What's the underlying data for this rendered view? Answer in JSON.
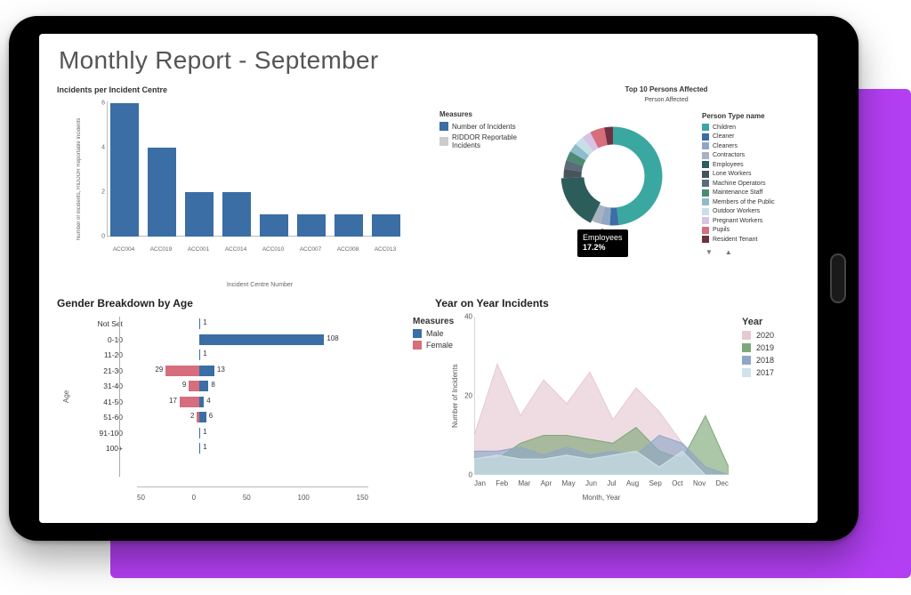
{
  "page_title": "Monthly Report - September",
  "chart_data": [
    {
      "id": "incidents_per_centre",
      "type": "bar",
      "title": "Incidents per Incident Centre",
      "xlabel": "Incident Centre Number",
      "ylabel": "Number of Incidents, RIDDOR Reportable Incidents",
      "ylim": [
        0,
        6
      ],
      "yticks": [
        0,
        2,
        4,
        6
      ],
      "categories": [
        "ACC004",
        "ACC019",
        "ACC001",
        "ACC014",
        "ACC010",
        "ACC007",
        "ACC008",
        "ACC013"
      ],
      "series": [
        {
          "name": "Number of Incidents",
          "values": [
            6,
            4,
            2,
            2,
            1,
            1,
            1,
            1
          ],
          "color": "#3a6ea5"
        }
      ],
      "legend_title": "Measures",
      "legend_items": [
        {
          "label": "Number of Incidents",
          "color": "#3a6ea5"
        },
        {
          "label": "RIDDOR Reportable Incidents",
          "color": "#cccccc"
        }
      ]
    },
    {
      "id": "persons_affected",
      "type": "pie",
      "title": "Top 10 Persons Affected",
      "subtitle": "Person Affected",
      "legend_title": "Person Type name",
      "slices": [
        {
          "label": "Children",
          "value": 48.0,
          "color": "#3aa7a0"
        },
        {
          "label": "Cleaner",
          "value": 3.0,
          "color": "#3a6ea5"
        },
        {
          "label": "Cleaners",
          "value": 3.0,
          "color": "#8fa7c6"
        },
        {
          "label": "Contractors",
          "value": 3.0,
          "color": "#a7b3c0"
        },
        {
          "label": "Employees",
          "value": 17.2,
          "color": "#2c5d5a"
        },
        {
          "label": "Lone Workers",
          "value": 3.0,
          "color": "#46555c"
        },
        {
          "label": "Machine Operators",
          "value": 3.0,
          "color": "#5b6c78"
        },
        {
          "label": "Maintenance Staff",
          "value": 3.0,
          "color": "#4c8a73"
        },
        {
          "label": "Members of the Public",
          "value": 3.0,
          "color": "#8fbccc"
        },
        {
          "label": "Outdoor Workers",
          "value": 3.0,
          "color": "#c7e0e7"
        },
        {
          "label": "Pregnant Workers",
          "value": 3.0,
          "color": "#d7c3e5"
        },
        {
          "label": "Pupils",
          "value": 4.8,
          "color": "#d66e7d"
        },
        {
          "label": "Resident Tenant",
          "value": 3.0,
          "color": "#6e3242"
        }
      ],
      "tooltip": {
        "label": "Employees",
        "value": "17.2%"
      },
      "nav_prev": "▼",
      "nav_next": "▲"
    },
    {
      "id": "gender_breakdown",
      "type": "bar",
      "orientation": "horizontal-diverging",
      "title": "Gender Breakdown by Age",
      "ylabel": "Age",
      "xlim": [
        -50,
        150
      ],
      "xticks": [
        -50,
        0,
        50,
        100,
        150
      ],
      "legend_title": "Measures",
      "categories": [
        "Not Set",
        "0-10",
        "11-20",
        "21-30",
        "31-40",
        "41-50",
        "51-60",
        "91-100",
        "100+"
      ],
      "series": [
        {
          "name": "Male",
          "color": "#3a6ea5",
          "values": [
            1,
            108,
            1,
            13,
            8,
            4,
            6,
            1,
            1
          ]
        },
        {
          "name": "Female",
          "color": "#d66e7d",
          "values": [
            0,
            0,
            0,
            29,
            9,
            17,
            2,
            0,
            0
          ]
        }
      ]
    },
    {
      "id": "yoy_incidents",
      "type": "area",
      "title": "Year on Year Incidents",
      "xlabel": "Month, Year",
      "ylabel": "Number of Incidents",
      "ylim": [
        0,
        40
      ],
      "yticks": [
        0,
        20,
        40
      ],
      "legend_title": "Year",
      "x": [
        "Jan",
        "Feb",
        "Mar",
        "Apr",
        "May",
        "Jun",
        "Jul",
        "Aug",
        "Sep",
        "Oct",
        "Nov",
        "Dec"
      ],
      "series": [
        {
          "name": "2020",
          "color": "#e6c9d3",
          "values": [
            10,
            28,
            15,
            24,
            18,
            26,
            14,
            22,
            16,
            8,
            0,
            0
          ]
        },
        {
          "name": "2019",
          "color": "#7fa87a",
          "values": [
            4,
            4,
            8,
            10,
            10,
            9,
            8,
            12,
            6,
            4,
            15,
            2
          ]
        },
        {
          "name": "2018",
          "color": "#8fa7c6",
          "values": [
            6,
            6,
            7,
            5,
            7,
            5,
            6,
            5,
            10,
            8,
            2,
            0
          ]
        },
        {
          "name": "2017",
          "color": "#cfe3ea",
          "values": [
            4,
            5,
            4,
            4,
            5,
            4,
            5,
            6,
            2,
            6,
            0,
            0
          ]
        }
      ]
    }
  ]
}
